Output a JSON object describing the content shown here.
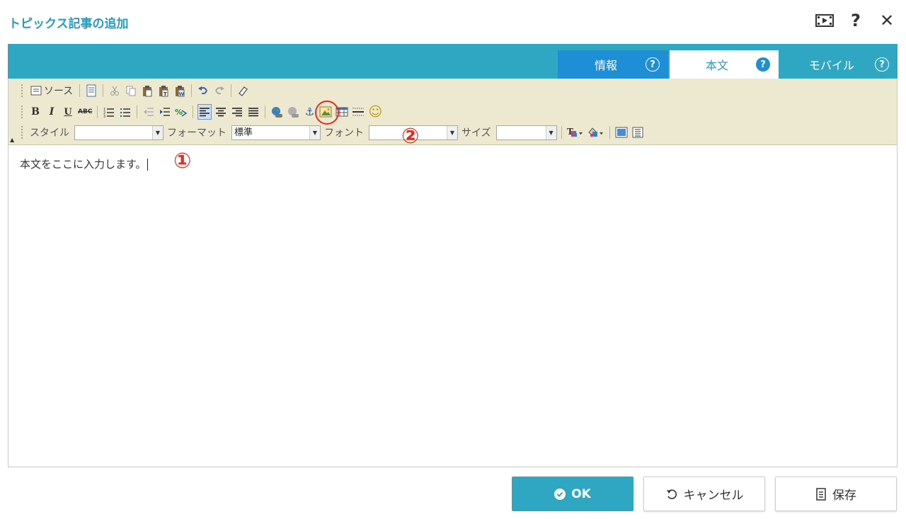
{
  "window": {
    "title": "トピックス記事の追加",
    "icons": [
      "film-icon",
      "help-icon",
      "close-icon"
    ],
    "help_glyph": "?",
    "close_glyph": "✕"
  },
  "tabs": [
    {
      "label": "情報",
      "help": "?",
      "active": false
    },
    {
      "label": "本文",
      "help": "?",
      "active": true
    },
    {
      "label": "モバイル",
      "help": "?",
      "active": false
    }
  ],
  "toolbar": {
    "source_label": "ソース",
    "style_label": "スタイル",
    "style_value": "",
    "format_label": "フォーマット",
    "format_value": "標準",
    "font_label": "フォント",
    "font_value": "",
    "size_label": "サイズ",
    "size_value": "",
    "bold": "B",
    "italic": "I",
    "underline": "U",
    "strike": "ABC",
    "anchor_glyph": "⚓",
    "smiley_glyph": "☺",
    "collapse_glyph": "▲",
    "dropdown_glyph": "▼"
  },
  "editor": {
    "content": "本文をここに入力します。"
  },
  "markers": {
    "one": "①",
    "two": "②"
  },
  "footer": {
    "ok_label": "OK",
    "cancel_label": "キャンセル",
    "save_label": "保存"
  },
  "colors": {
    "accent": "#2fa6c2",
    "title": "#2a9bbd",
    "active_tab_help": "#1e8fd6",
    "annotation": "#e42b1e",
    "toolbar_bg": "#ece9d0"
  }
}
